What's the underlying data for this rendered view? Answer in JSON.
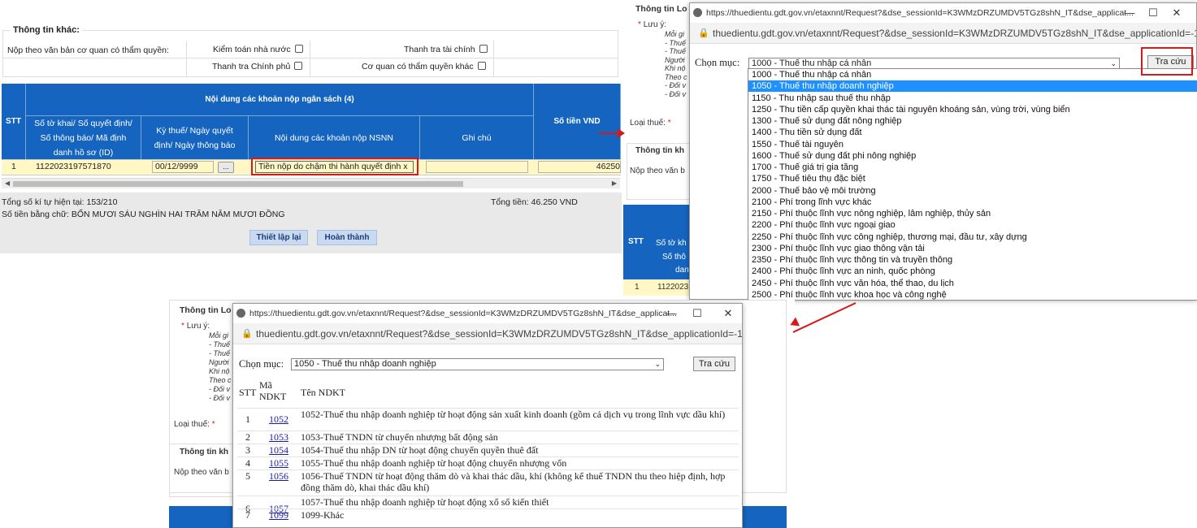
{
  "panelA": {
    "section_title": "Thông tin khác:",
    "row_label": "Nộp theo văn bản cơ quan có thẩm quyền:",
    "checks": [
      "Kiểm toán nhà nước",
      "Thanh tra tài chính",
      "Thanh tra Chính phủ",
      "Cơ quan có thẩm quyền khác"
    ],
    "table": {
      "stt": "STT",
      "group_header": "Nội dung các khoản nộp ngân sách (4)",
      "col1": "Số tờ khai/ Số quyết định/ Số thông báo/ Mã định danh hồ sơ (ID)",
      "col2": "Kỳ thuế/ Ngày quyết định/ Ngày thông báo",
      "col3": "Nội dung các khoản nộp NSNN",
      "col4": "Ghi chú",
      "col5": "Số tiền VND",
      "row": {
        "stt": "1",
        "id": "1122023197571870",
        "date": "00/12/9999",
        "btn": "...",
        "content": "Tiền nộp do chậm thi hành quyết định x",
        "amount": "46250"
      }
    },
    "total_signatures": "Tổng số kí tự hiện tại: 153/210",
    "total_amount": "Tổng tiền: 46.250 VND",
    "amount_words": "Số tiền bằng chữ: BỐN MƯƠI SÁU NGHÌN HAI TRĂM NĂM MƯƠI ĐỒNG",
    "btn_reset": "Thiết lập lại",
    "btn_done": "Hoàn thành"
  },
  "bg": {
    "info_lo": "Thông tin Lo",
    "luu_y": "Lưu ý:",
    "notes": [
      "Mỗi gi",
      "- Thuế",
      "- Thuế",
      "Người",
      "Khi nộ",
      "Theo c",
      "- Đối v",
      "- Đối v"
    ],
    "loai_thue": "Loại thuế:",
    "info_kh": "Thông tin kh",
    "nop_theo": "Nộp theo văn b",
    "stt": "STT",
    "so_to": "Số tờ kh",
    "so_tho": "Số thô",
    "dan": "dan",
    "row_stt": "1",
    "row_id": "11220231"
  },
  "popupB": {
    "title": "https://thuedientu.gdt.gov.vn/etaxnnt/Request?&dse_sessionId=K3WMzDRZUMDV5TGz8shN_IT&dse_applicat...",
    "url": "thuedientu.gdt.gov.vn/etaxnnt/Request?&dse_sessionId=K3WMzDRZUMDV5TGz8shN_IT&dse_applicationId=-1...",
    "label": "Chọn mục:",
    "selected": "1000 - Thuế thu nhập cá nhân",
    "btn": "Tra cứu",
    "options": [
      "1000 - Thuế thu nhập cá nhân",
      "1050 - Thuế thu nhập doanh nghiệp",
      "1150 - Thu nhập sau thuế thu nhập",
      "1250 - Thu tiền cấp quyền khai thác tài nguyên khoáng sản, vùng trời, vùng biển",
      "1300 - Thuế sử dụng đất nông nghiệp",
      "1400 - Thu tiền sử dụng đất",
      "1550 - Thuế tài nguyên",
      "1600 - Thuế sử dụng đất phi nông nghiệp",
      "1700 - Thuế giá trị gia tăng",
      "1750 - Thuế tiêu thụ đặc biệt",
      "2000 - Thuế bảo vệ môi trường",
      "2100 - Phí trong lĩnh vực khác",
      "2150 - Phí thuộc lĩnh vực nông nghiệp, lâm nghiệp, thủy sản",
      "2200 - Phí thuộc lĩnh vực ngoại giao",
      "2250 - Phí thuộc lĩnh vực công nghiệp, thương mại, đầu tư, xây dựng",
      "2300 - Phí thuộc lĩnh vực giao thông vận tải",
      "2350 - Phí thuộc lĩnh vực thông tin và truyền thông",
      "2400 - Phí thuộc lĩnh vực an ninh, quốc phòng",
      "2450 - Phí thuộc lĩnh vực văn hóa, thể thao, du lịch",
      "2500 - Phí thuộc lĩnh vực khoa học và công nghệ"
    ],
    "highlight_index": 1
  },
  "popupC": {
    "title": "https://thuedientu.gdt.gov.vn/etaxnnt/Request?&dse_sessionId=K3WMzDRZUMDV5TGz8shN_IT&dse_applicat...",
    "url": "thuedientu.gdt.gov.vn/etaxnnt/Request?&dse_sessionId=K3WMzDRZUMDV5TGz8shN_IT&dse_applicationId=-1...",
    "label": "Chọn mục:",
    "selected": "1050 - Thuế thu nhập doanh nghiệp",
    "btn": "Tra cứu",
    "headers": {
      "stt": "STT",
      "ma": "Mã NDKT",
      "ten": "Tên NDKT"
    },
    "rows": [
      {
        "stt": "1",
        "ma": "1052",
        "ten": "1052-Thuế thu nhập doanh nghiệp từ hoạt động sản xuất kinh doanh (gồm cả dịch vụ trong lĩnh vực dầu khí)"
      },
      {
        "stt": "2",
        "ma": "1053",
        "ten": "1053-Thuế TNDN từ chuyển nhượng bất động sản"
      },
      {
        "stt": "3",
        "ma": "1054",
        "ten": "1054-Thuế thu nhập DN từ hoạt động chuyển quyền thuê đất"
      },
      {
        "stt": "4",
        "ma": "1055",
        "ten": "1055-Thuế thu nhập doanh nghiệp từ hoạt động chuyển nhượng vốn"
      },
      {
        "stt": "5",
        "ma": "1056",
        "ten": "1056-Thuế TNDN từ hoạt động thăm dò và khai thác dầu, khí (không kể thuế TNDN thu theo hiệp định, hợp đồng thăm dò, khai thác dầu khí)"
      },
      {
        "stt": "6",
        "ma": "1057",
        "ten": "1057-Thuế thu nhập doanh nghiệp từ hoạt động xổ số kiến thiết"
      },
      {
        "stt": "7",
        "ma": "1099",
        "ten": "1099-Khác"
      }
    ]
  },
  "colors": {
    "header_blue": "#1565c0",
    "highlight_blue": "#1e90ff",
    "input_yellow": "#fff8c4",
    "annotation_red": "#d61a1a"
  }
}
